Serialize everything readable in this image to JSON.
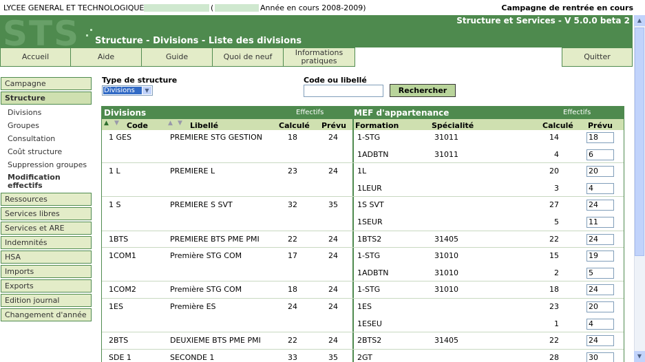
{
  "header": {
    "school": "LYCEE GENERAL ET TECHNOLOGIQUE",
    "paren": "(",
    "year": "Année en cours 2008-2009)",
    "campaign": "Campagne de rentrée en cours"
  },
  "banner": {
    "logo": "STS",
    "version": "Structure et Services - V 5.0.0 beta 2",
    "title": "Structure - Divisions - Liste des divisions"
  },
  "topnav": [
    "Accueil",
    "Aide",
    "Guide",
    "Quoi de neuf",
    "Informations pratiques",
    "Quitter"
  ],
  "sidebar": {
    "campagne": "Campagne",
    "structure": "Structure",
    "sub": [
      "Divisions",
      "Groupes",
      "Consultation",
      "Coût structure",
      "Suppression groupes",
      "Modification effectifs"
    ],
    "items": [
      "Ressources",
      "Services libres",
      "Services et ARE",
      "Indemnités",
      "HSA",
      "Imports",
      "Exports",
      "Edition journal",
      "Changement d'année"
    ]
  },
  "filters": {
    "type_label": "Type de structure",
    "type_value": "Divisions",
    "code_label": "Code ou libellé",
    "code_value": "",
    "search_label": "Rechercher"
  },
  "table": {
    "left_title": "Divisions",
    "left_effectifs": "Effectifs",
    "right_title": "MEF d'appartenance",
    "right_effectifs": "Effectifs",
    "cols": {
      "code": "Code",
      "libelle": "Libellé",
      "calcule": "Calculé",
      "prevu": "Prévu",
      "formation": "Formation",
      "specialite": "Spécialité",
      "calcule2": "Calculé",
      "prevu2": "Prévu"
    },
    "divisions": [
      {
        "code": "1 GES",
        "libelle": "PREMIERE STG GESTION",
        "calcule": "18",
        "prevu": "24",
        "mef": [
          {
            "formation": "1-STG",
            "specialite": "31011",
            "calcule": "14",
            "prevu": "18"
          },
          {
            "formation": "1ADBTN",
            "specialite": "31011",
            "calcule": "4",
            "prevu": "6"
          }
        ]
      },
      {
        "code": "1 L",
        "libelle": "PREMIERE L",
        "calcule": "23",
        "prevu": "24",
        "mef": [
          {
            "formation": "1L",
            "specialite": "",
            "calcule": "20",
            "prevu": "20"
          },
          {
            "formation": "1LEUR",
            "specialite": "",
            "calcule": "3",
            "prevu": "4"
          }
        ]
      },
      {
        "code": "1 S",
        "libelle": "PREMIERE S SVT",
        "calcule": "32",
        "prevu": "35",
        "mef": [
          {
            "formation": "1S SVT",
            "specialite": "",
            "calcule": "27",
            "prevu": "24"
          },
          {
            "formation": "1SEUR",
            "specialite": "",
            "calcule": "5",
            "prevu": "11"
          }
        ]
      },
      {
        "code": "1BTS",
        "libelle": "PREMIERE BTS PME PMI",
        "calcule": "22",
        "prevu": "24",
        "mef": [
          {
            "formation": "1BTS2",
            "specialite": "31405",
            "calcule": "22",
            "prevu": "24"
          }
        ]
      },
      {
        "code": "1COM1",
        "libelle": "Première STG COM",
        "calcule": "17",
        "prevu": "24",
        "mef": [
          {
            "formation": "1-STG",
            "specialite": "31010",
            "calcule": "15",
            "prevu": "19"
          },
          {
            "formation": "1ADBTN",
            "specialite": "31010",
            "calcule": "2",
            "prevu": "5"
          }
        ]
      },
      {
        "code": "1COM2",
        "libelle": "Première STG COM",
        "calcule": "18",
        "prevu": "24",
        "mef": [
          {
            "formation": "1-STG",
            "specialite": "31010",
            "calcule": "18",
            "prevu": "24"
          }
        ]
      },
      {
        "code": "1ES",
        "libelle": "Première ES",
        "calcule": "24",
        "prevu": "24",
        "mef": [
          {
            "formation": "1ES",
            "specialite": "",
            "calcule": "23",
            "prevu": "20"
          },
          {
            "formation": "1ESEU",
            "specialite": "",
            "calcule": "1",
            "prevu": "4"
          }
        ]
      },
      {
        "code": "2BTS",
        "libelle": "DEUXIEME BTS PME PMI",
        "calcule": "22",
        "prevu": "24",
        "mef": [
          {
            "formation": "2BTS2",
            "specialite": "31405",
            "calcule": "22",
            "prevu": "24"
          }
        ]
      },
      {
        "code": "SDE 1",
        "libelle": "SECONDE 1",
        "calcule": "33",
        "prevu": "35",
        "mef": [
          {
            "formation": "2GT",
            "specialite": "",
            "calcule": "28",
            "prevu": "30"
          }
        ]
      }
    ]
  },
  "colors": {
    "green": "#4e8a4e",
    "light_green": "#e3ecc8",
    "header_green": "#cfe0b0"
  }
}
